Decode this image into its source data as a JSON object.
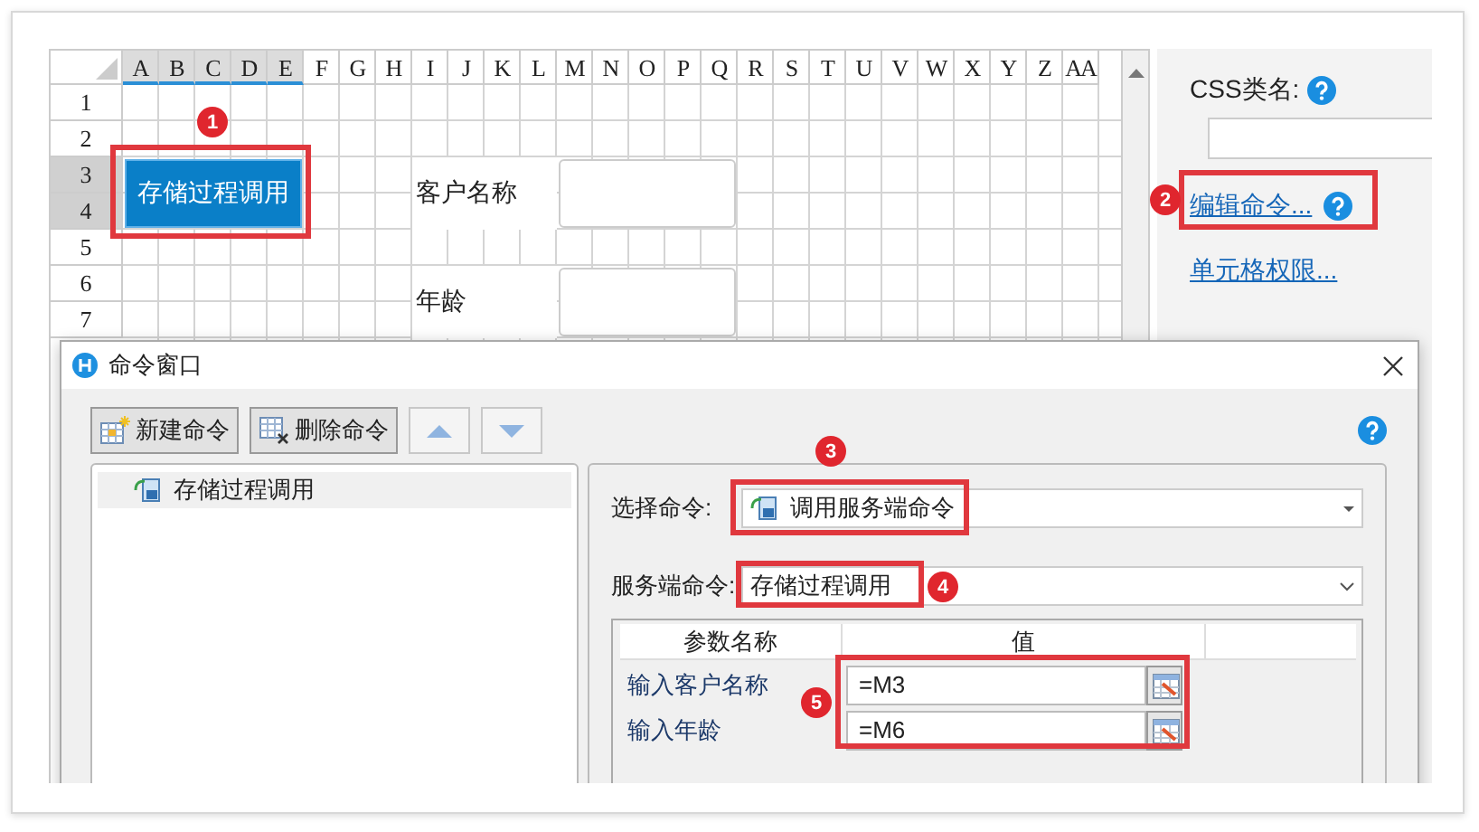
{
  "sheet": {
    "columns": [
      {
        "label": "A",
        "selected": true
      },
      {
        "label": "B",
        "selected": true
      },
      {
        "label": "C",
        "selected": true
      },
      {
        "label": "D",
        "selected": true
      },
      {
        "label": "E",
        "selected": true
      },
      {
        "label": "F",
        "selected": false
      },
      {
        "label": "G",
        "selected": false
      },
      {
        "label": "H",
        "selected": false
      },
      {
        "label": "I",
        "selected": false
      },
      {
        "label": "J",
        "selected": false
      },
      {
        "label": "K",
        "selected": false
      },
      {
        "label": "L",
        "selected": false
      },
      {
        "label": "M",
        "selected": false
      },
      {
        "label": "N",
        "selected": false
      },
      {
        "label": "O",
        "selected": false
      },
      {
        "label": "P",
        "selected": false
      },
      {
        "label": "Q",
        "selected": false
      },
      {
        "label": "R",
        "selected": false
      },
      {
        "label": "S",
        "selected": false
      },
      {
        "label": "T",
        "selected": false
      },
      {
        "label": "U",
        "selected": false
      },
      {
        "label": "V",
        "selected": false
      },
      {
        "label": "W",
        "selected": false
      },
      {
        "label": "X",
        "selected": false
      },
      {
        "label": "Y",
        "selected": false
      },
      {
        "label": "Z",
        "selected": false
      },
      {
        "label": "AA",
        "selected": false
      }
    ],
    "rows": [
      {
        "label": "1",
        "selected": false
      },
      {
        "label": "2",
        "selected": false
      },
      {
        "label": "3",
        "selected": true
      },
      {
        "label": "4",
        "selected": true
      },
      {
        "label": "5",
        "selected": false
      },
      {
        "label": "6",
        "selected": false
      },
      {
        "label": "7",
        "selected": false
      }
    ],
    "button": {
      "label": "存储过程调用"
    },
    "fields": [
      {
        "label": "客户名称"
      },
      {
        "label": "年龄"
      }
    ]
  },
  "properties": {
    "css_class_label": "CSS类名:",
    "links": [
      {
        "label": "编辑命令...",
        "help": true
      },
      {
        "label": "单元格权限...",
        "help": false
      }
    ]
  },
  "dialog": {
    "title": "命令窗口",
    "toolbar": [
      {
        "kind": "new",
        "label": "新建命令"
      },
      {
        "kind": "delete",
        "label": "删除命令"
      },
      {
        "kind": "up"
      },
      {
        "kind": "down"
      }
    ],
    "commands": [
      {
        "label": "存储过程调用",
        "selected": true
      }
    ],
    "select_command": {
      "label": "选择命令:",
      "value": "调用服务端命令"
    },
    "server_command": {
      "label": "服务端命令:",
      "value": "存储过程调用"
    },
    "parameters": {
      "columns": [
        "参数名称",
        "值"
      ],
      "rows": [
        {
          "name": "输入客户名称",
          "value": "=M3"
        },
        {
          "name": "输入年龄",
          "value": "=M6"
        }
      ]
    }
  },
  "callouts": [
    "1",
    "2",
    "3",
    "4",
    "5"
  ]
}
